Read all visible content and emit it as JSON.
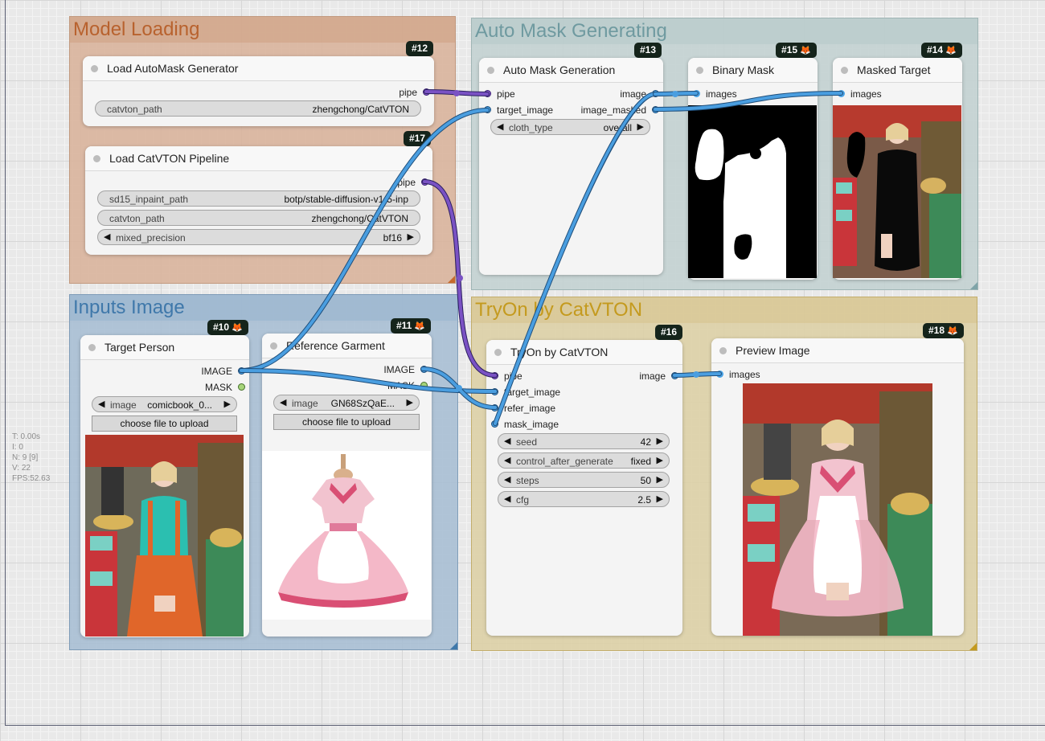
{
  "groups": {
    "model_loading": "Model Loading",
    "auto_mask": "Auto Mask Generating",
    "inputs_image": "Inputs Image",
    "tryon": "TryOn by CatVTON"
  },
  "badges": {
    "n12": "#12",
    "n13": "#13",
    "n15": "#15",
    "n14": "#14",
    "n17": "#17",
    "n10": "#10",
    "n11": "#11",
    "n16": "#16",
    "n18": "#18"
  },
  "nodes": {
    "automask_generator": {
      "title": "Load AutoMask Generator",
      "out_pipe": "pipe",
      "w_catvton_label": "catvton_path",
      "w_catvton_value": "zhengchong/CatVTON"
    },
    "catvton_pipeline": {
      "title": "Load CatVTON Pipeline",
      "out_pipe": "pipe",
      "w_sd15_label": "sd15_inpaint_path",
      "w_sd15_value": "botp/stable-diffusion-v1-5-inp",
      "w_catvton_label": "catvton_path",
      "w_catvton_value": "zhengchong/CatVTON",
      "w_precision_label": "mixed_precision",
      "w_precision_value": "bf16"
    },
    "auto_mask_generation": {
      "title": "Auto Mask Generation",
      "in_pipe": "pipe",
      "in_target": "target_image",
      "out_image": "image",
      "out_image_masked": "image_masked",
      "w_cloth_label": "cloth_type",
      "w_cloth_value": "overall"
    },
    "binary_mask": {
      "title": "Binary Mask",
      "in_images": "images"
    },
    "masked_target": {
      "title": "Masked Target",
      "in_images": "images"
    },
    "target_person": {
      "title": "Target Person",
      "out_image": "IMAGE",
      "out_mask": "MASK",
      "w_image_label": "image",
      "w_image_value": "comicbook_0...",
      "upload": "choose file to upload"
    },
    "reference_garment": {
      "title": "Reference Garment",
      "out_image": "IMAGE",
      "out_mask": "MASK",
      "w_image_label": "image",
      "w_image_value": "GN68SzQaE...",
      "upload": "choose file to upload"
    },
    "tryon_node": {
      "title": "TryOn by CatVTON",
      "in_pipe": "pipe",
      "in_target": "target_image",
      "in_refer": "refer_image",
      "in_mask": "mask_image",
      "out_image": "image",
      "w_seed_label": "seed",
      "w_seed_value": "42",
      "w_control_label": "control_after_generate",
      "w_control_value": "fixed",
      "w_steps_label": "steps",
      "w_steps_value": "50",
      "w_cfg_label": "cfg",
      "w_cfg_value": "2.5"
    },
    "preview_image": {
      "title": "Preview Image",
      "in_images": "images"
    }
  },
  "stats": {
    "t": "T: 0.00s",
    "i": "I: 0",
    "n": "N: 9 [9]",
    "v": "V: 22",
    "fps": "FPS:52.63"
  },
  "colors": {
    "model_loading_bg": "#d9b49c",
    "model_loading_title": "#b8622e",
    "auto_mask_bg": "#c3d2d2",
    "auto_mask_title": "#6f9aa0",
    "inputs_bg": "#a9bfd4",
    "inputs_title": "#3f78aa",
    "tryon_bg": "#ddd0a6",
    "tryon_title": "#c49a1e",
    "link_pipe": "#7a52c4",
    "link_image": "#4a9ee0"
  },
  "icons": {
    "left_arrow": "left-arrow-icon",
    "right_arrow": "right-arrow-icon",
    "fox": "fox-icon"
  }
}
